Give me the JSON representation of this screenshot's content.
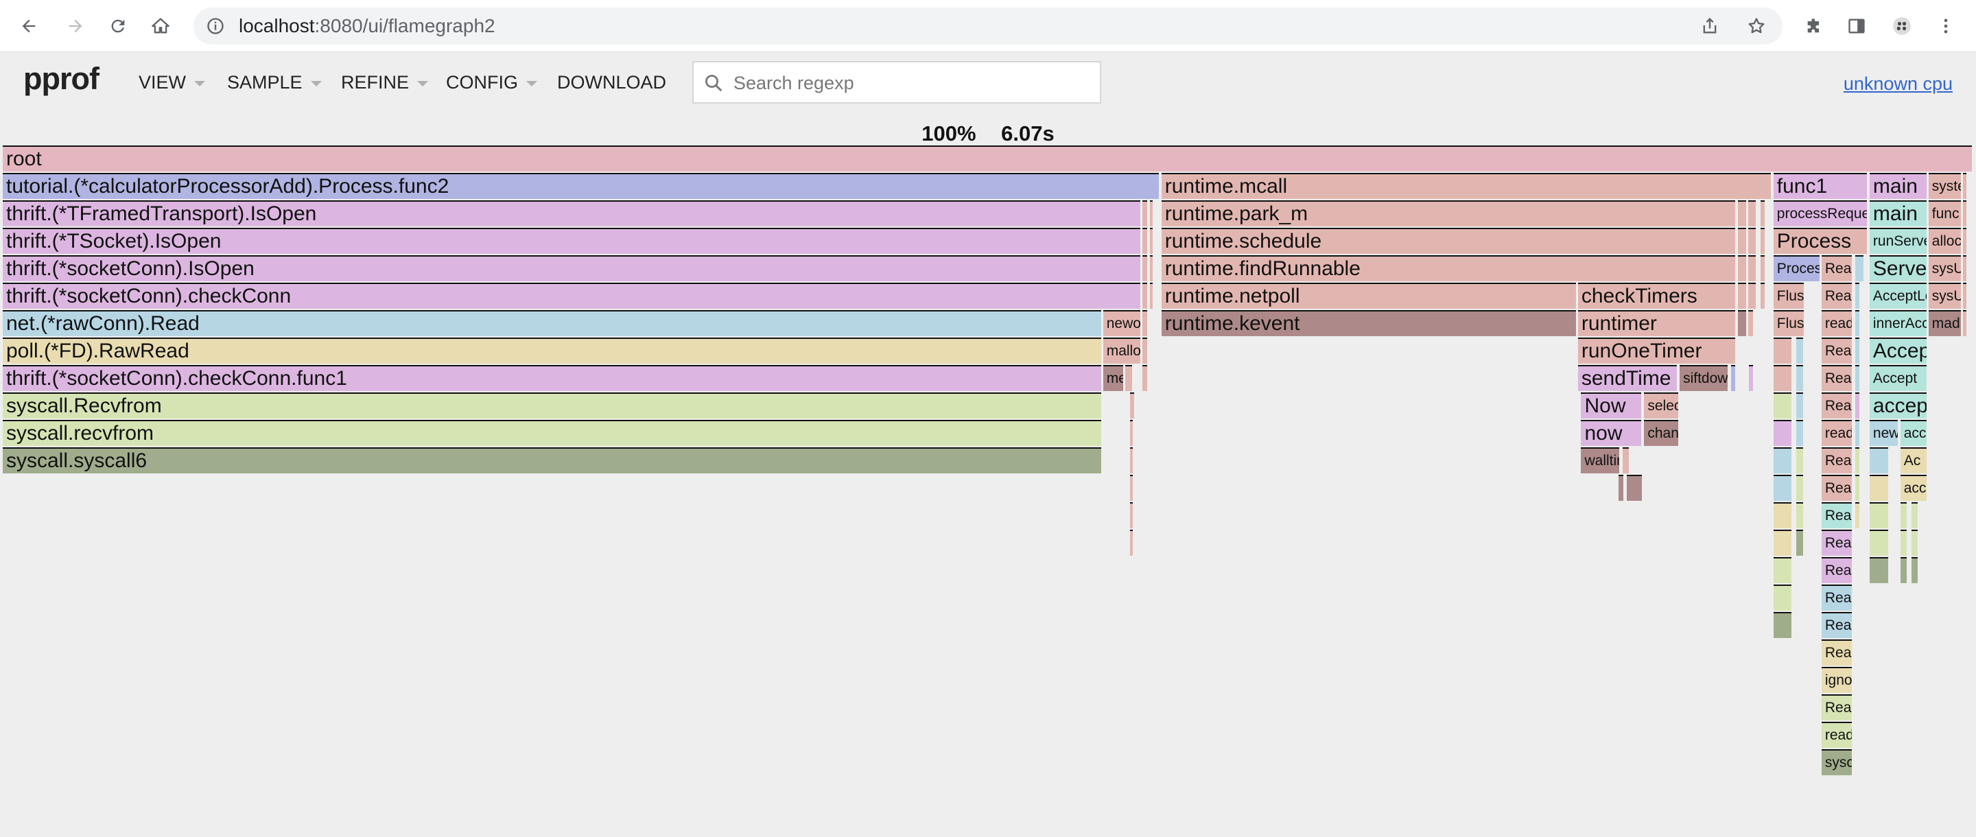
{
  "browser": {
    "url_host": "localhost",
    "url_path": ":8080/ui/flamegraph2"
  },
  "app": {
    "logo": "pprof",
    "menus": [
      "VIEW",
      "SAMPLE",
      "REFINE",
      "CONFIG",
      "DOWNLOAD"
    ],
    "search_placeholder": "Search regexp",
    "cpu_link": "unknown cpu"
  },
  "summary": {
    "percent": "100%",
    "total": "6.07s"
  },
  "colors": {
    "root": "#e5b6c0",
    "blue": "#b0b4e2",
    "purple": "#dcb6e0",
    "salmon": "#e2b6b0",
    "dark_salmon": "#ad8a89",
    "light_blue": "#b6d6e4",
    "yellow": "#e8dcb0",
    "green": "#d6e4b4",
    "olive": "#a0ad8c",
    "teal": "#b4e4dc"
  },
  "frames": [
    {
      "d": 0,
      "x": 0.0,
      "w": 100.0,
      "c": "root",
      "t": "root"
    },
    {
      "d": 1,
      "x": 0.0,
      "w": 58.75,
      "c": "blue",
      "t": "tutorial.(*calculatorProcessorAdd).Process.func2"
    },
    {
      "d": 1,
      "x": 58.8,
      "w": 31.0,
      "c": "salmon",
      "t": "runtime.mcall"
    },
    {
      "d": 1,
      "x": 89.86,
      "w": 4.8,
      "c": "purple",
      "t": "func1"
    },
    {
      "d": 1,
      "x": 94.74,
      "w": 2.95,
      "c": "purple",
      "t": "main"
    },
    {
      "d": 1,
      "x": 97.73,
      "w": 1.72,
      "c": "salmon",
      "t": "syste",
      "sm": true
    },
    {
      "d": 1,
      "x": 99.48,
      "w": 0.25,
      "c": "salmon",
      "t": ""
    },
    {
      "d": 2,
      "x": 0.0,
      "w": 57.8,
      "c": "purple",
      "t": "thrift.(*TFramedTransport).IsOpen"
    },
    {
      "d": 2,
      "x": 57.84,
      "w": 0.3,
      "c": "salmon",
      "t": ""
    },
    {
      "d": 2,
      "x": 58.2,
      "w": 0.15,
      "c": "salmon",
      "t": ""
    },
    {
      "d": 2,
      "x": 58.8,
      "w": 29.2,
      "c": "salmon",
      "t": "runtime.park_m"
    },
    {
      "d": 2,
      "x": 88.04,
      "w": 0.5,
      "c": "salmon",
      "t": ""
    },
    {
      "d": 2,
      "x": 88.58,
      "w": 0.45,
      "c": "salmon",
      "t": ""
    },
    {
      "d": 2,
      "x": 89.2,
      "w": 0.3,
      "c": "salmon",
      "t": ""
    },
    {
      "d": 2,
      "x": 89.86,
      "w": 4.8,
      "c": "purple",
      "t": "processRequest",
      "sm": true
    },
    {
      "d": 2,
      "x": 94.74,
      "w": 2.95,
      "c": "teal",
      "t": "main"
    },
    {
      "d": 2,
      "x": 97.73,
      "w": 1.72,
      "c": "salmon",
      "t": "func",
      "sm": true
    },
    {
      "d": 2,
      "x": 99.48,
      "w": 0.25,
      "c": "salmon",
      "t": ""
    },
    {
      "d": 3,
      "x": 0.0,
      "w": 57.8,
      "c": "purple",
      "t": "thrift.(*TSocket).IsOpen"
    },
    {
      "d": 3,
      "x": 57.84,
      "w": 0.3,
      "c": "salmon",
      "t": ""
    },
    {
      "d": 3,
      "x": 58.2,
      "w": 0.15,
      "c": "salmon",
      "t": ""
    },
    {
      "d": 3,
      "x": 58.8,
      "w": 29.2,
      "c": "salmon",
      "t": "runtime.schedule"
    },
    {
      "d": 3,
      "x": 88.04,
      "w": 0.5,
      "c": "salmon",
      "t": ""
    },
    {
      "d": 3,
      "x": 88.58,
      "w": 0.45,
      "c": "salmon",
      "t": ""
    },
    {
      "d": 3,
      "x": 89.2,
      "w": 0.3,
      "c": "salmon",
      "t": ""
    },
    {
      "d": 3,
      "x": 89.86,
      "w": 4.8,
      "c": "salmon",
      "t": "Process"
    },
    {
      "d": 3,
      "x": 94.74,
      "w": 2.95,
      "c": "teal",
      "t": "runServer",
      "sm": true
    },
    {
      "d": 3,
      "x": 97.73,
      "w": 1.72,
      "c": "salmon",
      "t": "alloc",
      "sm": true
    },
    {
      "d": 3,
      "x": 99.48,
      "w": 0.25,
      "c": "salmon",
      "t": ""
    },
    {
      "d": 4,
      "x": 0.0,
      "w": 57.8,
      "c": "purple",
      "t": "thrift.(*socketConn).IsOpen"
    },
    {
      "d": 4,
      "x": 57.84,
      "w": 0.3,
      "c": "salmon",
      "t": ""
    },
    {
      "d": 4,
      "x": 58.2,
      "w": 0.15,
      "c": "salmon",
      "t": ""
    },
    {
      "d": 4,
      "x": 58.8,
      "w": 29.2,
      "c": "salmon",
      "t": "runtime.findRunnable"
    },
    {
      "d": 4,
      "x": 88.04,
      "w": 0.5,
      "c": "salmon",
      "t": ""
    },
    {
      "d": 4,
      "x": 88.58,
      "w": 0.45,
      "c": "salmon",
      "t": ""
    },
    {
      "d": 4,
      "x": 89.2,
      "w": 0.3,
      "c": "salmon",
      "t": ""
    },
    {
      "d": 4,
      "x": 89.86,
      "w": 2.4,
      "c": "blue",
      "t": "Process",
      "sm": true
    },
    {
      "d": 4,
      "x": 92.3,
      "w": 1.6,
      "c": "salmon",
      "t": "Read",
      "sm": true
    },
    {
      "d": 4,
      "x": 94.0,
      "w": 0.5,
      "c": "light_blue",
      "t": ""
    },
    {
      "d": 4,
      "x": 94.74,
      "w": 2.95,
      "c": "teal",
      "t": "Server"
    },
    {
      "d": 4,
      "x": 97.73,
      "w": 1.72,
      "c": "salmon",
      "t": "sysU",
      "sm": true
    },
    {
      "d": 4,
      "x": 99.48,
      "w": 0.25,
      "c": "salmon",
      "t": ""
    },
    {
      "d": 5,
      "x": 0.0,
      "w": 57.8,
      "c": "purple",
      "t": "thrift.(*socketConn).checkConn"
    },
    {
      "d": 5,
      "x": 57.84,
      "w": 0.3,
      "c": "salmon",
      "t": ""
    },
    {
      "d": 5,
      "x": 58.2,
      "w": 0.15,
      "c": "salmon",
      "t": ""
    },
    {
      "d": 5,
      "x": 58.8,
      "w": 21.1,
      "c": "salmon",
      "t": "runtime.netpoll"
    },
    {
      "d": 5,
      "x": 79.94,
      "w": 8.06,
      "c": "salmon",
      "t": "checkTimers"
    },
    {
      "d": 5,
      "x": 88.04,
      "w": 0.5,
      "c": "salmon",
      "t": ""
    },
    {
      "d": 5,
      "x": 88.58,
      "w": 0.45,
      "c": "salmon",
      "t": ""
    },
    {
      "d": 5,
      "x": 89.2,
      "w": 0.3,
      "c": "salmon",
      "t": ""
    },
    {
      "d": 5,
      "x": 89.86,
      "w": 1.6,
      "c": "salmon",
      "t": "Flus",
      "sm": true
    },
    {
      "d": 5,
      "x": 92.3,
      "w": 1.6,
      "c": "salmon",
      "t": "Read",
      "sm": true
    },
    {
      "d": 5,
      "x": 94.0,
      "w": 0.3,
      "c": "light_blue",
      "t": ""
    },
    {
      "d": 5,
      "x": 94.74,
      "w": 2.95,
      "c": "teal",
      "t": "AcceptLoop",
      "sm": true
    },
    {
      "d": 5,
      "x": 97.73,
      "w": 1.72,
      "c": "salmon",
      "t": "sysU",
      "sm": true
    },
    {
      "d": 5,
      "x": 99.48,
      "w": 0.25,
      "c": "salmon",
      "t": ""
    },
    {
      "d": 6,
      "x": 0.0,
      "w": 55.8,
      "c": "light_blue",
      "t": "net.(*rawConn).Read"
    },
    {
      "d": 6,
      "x": 55.84,
      "w": 1.96,
      "c": "salmon",
      "t": "newo",
      "sm": true
    },
    {
      "d": 6,
      "x": 57.84,
      "w": 0.3,
      "c": "salmon",
      "t": ""
    },
    {
      "d": 6,
      "x": 58.8,
      "w": 21.1,
      "c": "dark_salmon",
      "t": "runtime.kevent"
    },
    {
      "d": 6,
      "x": 79.94,
      "w": 8.06,
      "c": "salmon",
      "t": "runtimer"
    },
    {
      "d": 6,
      "x": 88.04,
      "w": 0.5,
      "c": "dark_salmon",
      "t": ""
    },
    {
      "d": 6,
      "x": 88.58,
      "w": 0.3,
      "c": "salmon",
      "t": ""
    },
    {
      "d": 6,
      "x": 89.86,
      "w": 1.6,
      "c": "salmon",
      "t": "Flus",
      "sm": true
    },
    {
      "d": 6,
      "x": 92.3,
      "w": 1.6,
      "c": "salmon",
      "t": "read",
      "sm": true
    },
    {
      "d": 6,
      "x": 94.0,
      "w": 0.3,
      "c": "light_blue",
      "t": ""
    },
    {
      "d": 6,
      "x": 94.74,
      "w": 2.95,
      "c": "teal",
      "t": "innerAccept",
      "sm": true
    },
    {
      "d": 6,
      "x": 97.73,
      "w": 1.72,
      "c": "dark_salmon",
      "t": "mad",
      "sm": true
    },
    {
      "d": 6,
      "x": 99.48,
      "w": 0.25,
      "c": "salmon",
      "t": ""
    },
    {
      "d": 7,
      "x": 0.0,
      "w": 55.8,
      "c": "yellow",
      "t": "poll.(*FD).RawRead"
    },
    {
      "d": 7,
      "x": 55.84,
      "w": 1.96,
      "c": "salmon",
      "t": "mallo",
      "sm": true
    },
    {
      "d": 7,
      "x": 57.84,
      "w": 0.3,
      "c": "salmon",
      "t": ""
    },
    {
      "d": 7,
      "x": 79.94,
      "w": 8.06,
      "c": "salmon",
      "t": "runOneTimer"
    },
    {
      "d": 7,
      "x": 89.86,
      "w": 1.0,
      "c": "salmon",
      "t": ""
    },
    {
      "d": 7,
      "x": 91.0,
      "w": 0.45,
      "c": "light_blue",
      "t": ""
    },
    {
      "d": 7,
      "x": 92.3,
      "w": 1.6,
      "c": "salmon",
      "t": "Read",
      "sm": true
    },
    {
      "d": 7,
      "x": 94.0,
      "w": 0.3,
      "c": "light_blue",
      "t": ""
    },
    {
      "d": 7,
      "x": 94.74,
      "w": 2.95,
      "c": "teal",
      "t": "Accept"
    },
    {
      "d": 8,
      "x": 0.0,
      "w": 55.8,
      "c": "purple",
      "t": "thrift.(*socketConn).checkConn.func1"
    },
    {
      "d": 8,
      "x": 55.84,
      "w": 1.1,
      "c": "dark_salmon",
      "t": "me",
      "sm": true
    },
    {
      "d": 8,
      "x": 56.98,
      "w": 0.4,
      "c": "salmon",
      "t": ""
    },
    {
      "d": 8,
      "x": 57.84,
      "w": 0.3,
      "c": "salmon",
      "t": ""
    },
    {
      "d": 8,
      "x": 79.94,
      "w": 5.1,
      "c": "purple",
      "t": "sendTime"
    },
    {
      "d": 8,
      "x": 85.1,
      "w": 2.5,
      "c": "dark_salmon",
      "t": "siftdow",
      "sm": true
    },
    {
      "d": 8,
      "x": 87.7,
      "w": 0.3,
      "c": "blue",
      "t": ""
    },
    {
      "d": 8,
      "x": 88.6,
      "w": 0.3,
      "c": "purple",
      "t": ""
    },
    {
      "d": 8,
      "x": 89.86,
      "w": 1.0,
      "c": "salmon",
      "t": ""
    },
    {
      "d": 8,
      "x": 91.0,
      "w": 0.45,
      "c": "light_blue",
      "t": ""
    },
    {
      "d": 8,
      "x": 92.3,
      "w": 1.6,
      "c": "salmon",
      "t": "Read",
      "sm": true
    },
    {
      "d": 8,
      "x": 94.0,
      "w": 0.3,
      "c": "light_blue",
      "t": ""
    },
    {
      "d": 8,
      "x": 94.74,
      "w": 2.95,
      "c": "teal",
      "t": "Accept",
      "sm": true
    },
    {
      "d": 9,
      "x": 0.0,
      "w": 55.8,
      "c": "green",
      "t": "syscall.Recvfrom"
    },
    {
      "d": 9,
      "x": 57.2,
      "w": 0.3,
      "c": "salmon",
      "t": ""
    },
    {
      "d": 9,
      "x": 80.1,
      "w": 3.1,
      "c": "purple",
      "t": "Now"
    },
    {
      "d": 9,
      "x": 83.3,
      "w": 1.8,
      "c": "salmon",
      "t": "selec",
      "sm": true
    },
    {
      "d": 9,
      "x": 89.86,
      "w": 1.0,
      "c": "green",
      "t": ""
    },
    {
      "d": 9,
      "x": 91.0,
      "w": 0.45,
      "c": "light_blue",
      "t": ""
    },
    {
      "d": 9,
      "x": 92.3,
      "w": 1.6,
      "c": "salmon",
      "t": "Read",
      "sm": true
    },
    {
      "d": 9,
      "x": 94.0,
      "w": 0.3,
      "c": "purple",
      "t": ""
    },
    {
      "d": 9,
      "x": 94.74,
      "w": 2.95,
      "c": "teal",
      "t": "accept"
    },
    {
      "d": 10,
      "x": 0.0,
      "w": 55.8,
      "c": "green",
      "t": "syscall.recvfrom"
    },
    {
      "d": 10,
      "x": 57.2,
      "w": 0.2,
      "c": "salmon",
      "t": ""
    },
    {
      "d": 10,
      "x": 80.1,
      "w": 3.1,
      "c": "purple",
      "t": "now"
    },
    {
      "d": 10,
      "x": 83.3,
      "w": 1.8,
      "c": "dark_salmon",
      "t": "chan",
      "sm": true
    },
    {
      "d": 10,
      "x": 89.86,
      "w": 1.0,
      "c": "purple",
      "t": ""
    },
    {
      "d": 10,
      "x": 91.0,
      "w": 0.45,
      "c": "light_blue",
      "t": ""
    },
    {
      "d": 10,
      "x": 92.3,
      "w": 1.6,
      "c": "salmon",
      "t": "readl",
      "sm": true
    },
    {
      "d": 10,
      "x": 94.0,
      "w": 0.3,
      "c": "light_blue",
      "t": ""
    },
    {
      "d": 10,
      "x": 94.74,
      "w": 1.5,
      "c": "light_blue",
      "t": "new",
      "sm": true
    },
    {
      "d": 10,
      "x": 96.3,
      "w": 1.4,
      "c": "teal",
      "t": "acc",
      "sm": true
    },
    {
      "d": 11,
      "x": 0.0,
      "w": 55.8,
      "c": "olive",
      "t": "syscall.syscall6"
    },
    {
      "d": 11,
      "x": 57.2,
      "w": 0.2,
      "c": "salmon",
      "t": ""
    },
    {
      "d": 11,
      "x": 80.1,
      "w": 2.0,
      "c": "dark_salmon",
      "t": "walltim",
      "sm": true
    },
    {
      "d": 11,
      "x": 82.2,
      "w": 0.4,
      "c": "salmon",
      "t": ""
    },
    {
      "d": 11,
      "x": 89.86,
      "w": 1.0,
      "c": "light_blue",
      "t": ""
    },
    {
      "d": 11,
      "x": 91.0,
      "w": 0.45,
      "c": "green",
      "t": ""
    },
    {
      "d": 11,
      "x": 92.3,
      "w": 1.6,
      "c": "salmon",
      "t": "Read",
      "sm": true
    },
    {
      "d": 11,
      "x": 94.0,
      "w": 0.3,
      "c": "green",
      "t": ""
    },
    {
      "d": 11,
      "x": 94.74,
      "w": 1.0,
      "c": "light_blue",
      "t": ""
    },
    {
      "d": 11,
      "x": 96.3,
      "w": 1.4,
      "c": "yellow",
      "t": "Ac",
      "sm": true
    },
    {
      "d": 12,
      "x": 57.2,
      "w": 0.2,
      "c": "salmon",
      "t": ""
    },
    {
      "d": 12,
      "x": 82.0,
      "w": 0.3,
      "c": "dark_salmon",
      "t": ""
    },
    {
      "d": 12,
      "x": 82.4,
      "w": 0.85,
      "c": "dark_salmon",
      "t": ""
    },
    {
      "d": 12,
      "x": 89.86,
      "w": 1.0,
      "c": "light_blue",
      "t": ""
    },
    {
      "d": 12,
      "x": 91.0,
      "w": 0.45,
      "c": "green",
      "t": ""
    },
    {
      "d": 12,
      "x": 92.3,
      "w": 1.6,
      "c": "salmon",
      "t": "Read",
      "sm": true
    },
    {
      "d": 12,
      "x": 94.0,
      "w": 0.3,
      "c": "green",
      "t": ""
    },
    {
      "d": 12,
      "x": 94.74,
      "w": 1.0,
      "c": "yellow",
      "t": ""
    },
    {
      "d": 12,
      "x": 96.3,
      "w": 1.4,
      "c": "yellow",
      "t": "acc",
      "sm": true
    },
    {
      "d": 13,
      "x": 57.2,
      "w": 0.2,
      "c": "salmon",
      "t": ""
    },
    {
      "d": 13,
      "x": 89.86,
      "w": 1.0,
      "c": "yellow",
      "t": ""
    },
    {
      "d": 13,
      "x": 91.0,
      "w": 0.45,
      "c": "green",
      "t": ""
    },
    {
      "d": 13,
      "x": 92.3,
      "w": 1.6,
      "c": "teal",
      "t": "Read",
      "sm": true
    },
    {
      "d": 13,
      "x": 94.0,
      "w": 0.3,
      "c": "yellow",
      "t": ""
    },
    {
      "d": 13,
      "x": 94.74,
      "w": 1.0,
      "c": "green",
      "t": ""
    },
    {
      "d": 13,
      "x": 96.3,
      "w": 0.4,
      "c": "green",
      "t": ""
    },
    {
      "d": 13,
      "x": 96.85,
      "w": 0.4,
      "c": "green",
      "t": ""
    },
    {
      "d": 14,
      "x": 57.2,
      "w": 0.2,
      "c": "salmon",
      "t": ""
    },
    {
      "d": 14,
      "x": 89.86,
      "w": 1.0,
      "c": "yellow",
      "t": ""
    },
    {
      "d": 14,
      "x": 91.0,
      "w": 0.45,
      "c": "olive",
      "t": ""
    },
    {
      "d": 14,
      "x": 92.3,
      "w": 1.6,
      "c": "purple",
      "t": "Read",
      "sm": true
    },
    {
      "d": 14,
      "x": 94.74,
      "w": 1.0,
      "c": "green",
      "t": ""
    },
    {
      "d": 14,
      "x": 96.3,
      "w": 0.4,
      "c": "green",
      "t": ""
    },
    {
      "d": 14,
      "x": 96.85,
      "w": 0.4,
      "c": "green",
      "t": ""
    },
    {
      "d": 15,
      "x": 89.86,
      "w": 1.0,
      "c": "green",
      "t": ""
    },
    {
      "d": 15,
      "x": 92.3,
      "w": 1.6,
      "c": "purple",
      "t": "Read",
      "sm": true
    },
    {
      "d": 15,
      "x": 94.74,
      "w": 1.0,
      "c": "olive",
      "t": ""
    },
    {
      "d": 15,
      "x": 96.3,
      "w": 0.4,
      "c": "olive",
      "t": ""
    },
    {
      "d": 15,
      "x": 96.85,
      "w": 0.4,
      "c": "olive",
      "t": ""
    },
    {
      "d": 16,
      "x": 89.86,
      "w": 1.0,
      "c": "green",
      "t": ""
    },
    {
      "d": 16,
      "x": 92.3,
      "w": 1.6,
      "c": "light_blue",
      "t": "Read",
      "sm": true
    },
    {
      "d": 17,
      "x": 89.86,
      "w": 1.0,
      "c": "olive",
      "t": ""
    },
    {
      "d": 17,
      "x": 92.3,
      "w": 1.6,
      "c": "light_blue",
      "t": "Read",
      "sm": true
    },
    {
      "d": 18,
      "x": 92.3,
      "w": 1.6,
      "c": "yellow",
      "t": "Read",
      "sm": true
    },
    {
      "d": 19,
      "x": 92.3,
      "w": 1.6,
      "c": "yellow",
      "t": "ignor",
      "sm": true
    },
    {
      "d": 20,
      "x": 92.3,
      "w": 1.6,
      "c": "green",
      "t": "Read",
      "sm": true
    },
    {
      "d": 21,
      "x": 92.3,
      "w": 1.6,
      "c": "green",
      "t": "read",
      "sm": true
    },
    {
      "d": 22,
      "x": 92.3,
      "w": 1.6,
      "c": "olive",
      "t": "sysc",
      "sm": true
    }
  ]
}
